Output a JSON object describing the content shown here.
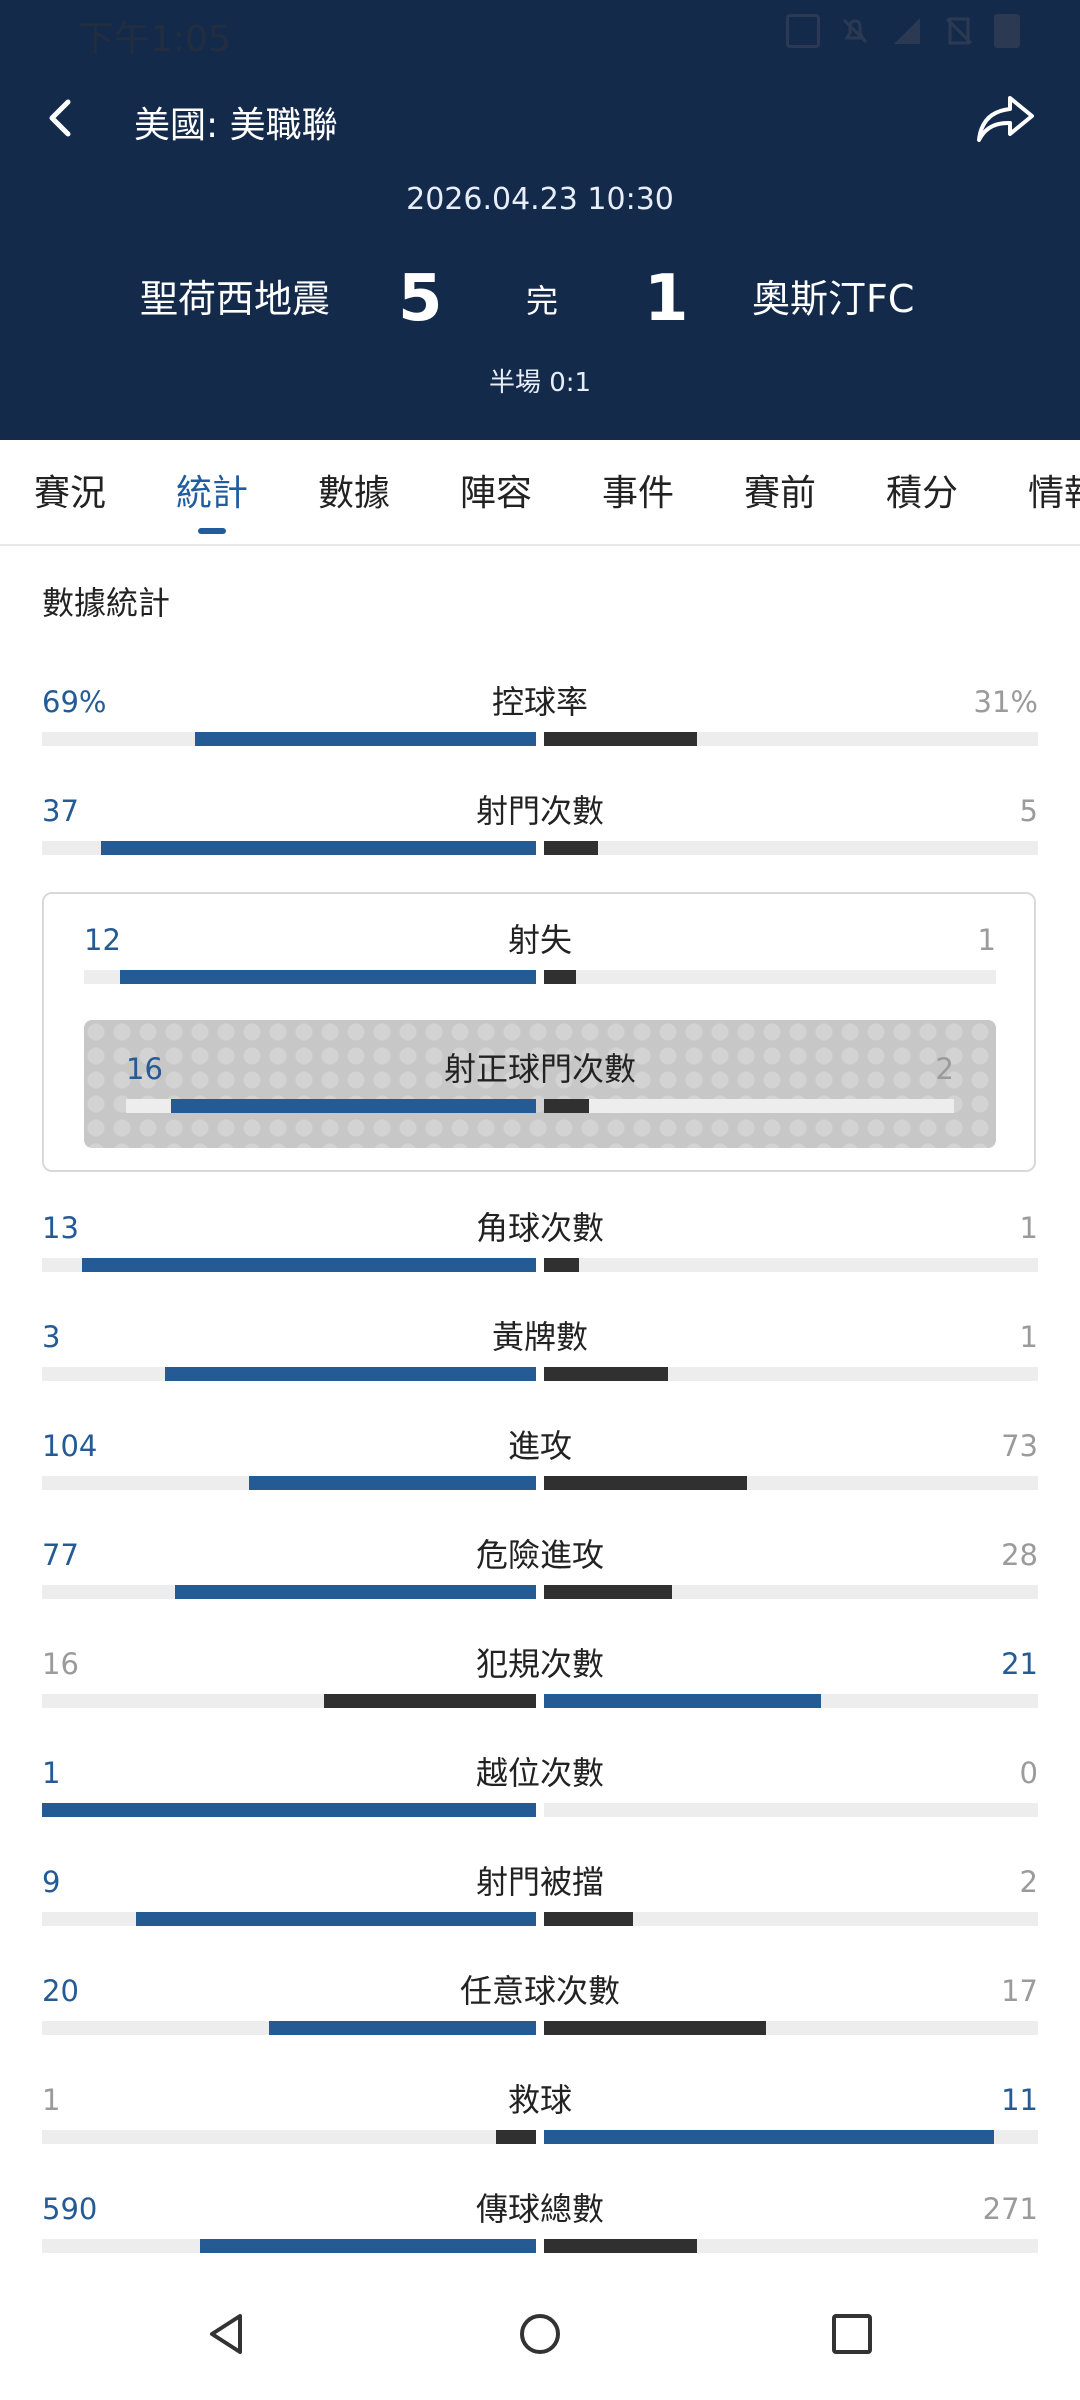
{
  "status": {
    "time": "下午1:05"
  },
  "header": {
    "league": "美國: 美職聯",
    "datetime": "2026.04.23 10:30",
    "home_team": "聖荷西地震",
    "away_team": "奧斯汀FC",
    "home_score": "5",
    "away_score": "1",
    "status": "完",
    "half_time": "半場 0:1"
  },
  "tabs": [
    "賽況",
    "統計",
    "數據",
    "陣容",
    "事件",
    "賽前",
    "積分",
    "情報"
  ],
  "active_tab": "統計",
  "section_title": "數據統計",
  "colors": {
    "header_bg": "#142a4b",
    "home_bar": "#255b95",
    "away_bar": "#303030",
    "track": "#ededed"
  },
  "stats": [
    {
      "label": "控球率",
      "home": "69%",
      "away": "31%",
      "home_frac": 0.69,
      "away_frac": 0.31,
      "leader": "home"
    },
    {
      "label": "射門次數",
      "home": "37",
      "away": "5",
      "home_frac": 0.88,
      "away_frac": 0.11,
      "leader": "home"
    },
    {
      "label": "射失",
      "home": "12",
      "away": "1",
      "home_frac": 0.92,
      "away_frac": 0.07,
      "leader": "home"
    },
    {
      "label": "射正球門次數",
      "home": "16",
      "away": "2",
      "home_frac": 0.89,
      "away_frac": 0.11,
      "leader": "home"
    },
    {
      "label": "角球次數",
      "home": "13",
      "away": "1",
      "home_frac": 0.92,
      "away_frac": 0.07,
      "leader": "home"
    },
    {
      "label": "黃牌數",
      "home": "3",
      "away": "1",
      "home_frac": 0.75,
      "away_frac": 0.25,
      "leader": "home"
    },
    {
      "label": "進攻",
      "home": "104",
      "away": "73",
      "home_frac": 0.58,
      "away_frac": 0.41,
      "leader": "home"
    },
    {
      "label": "危險進攻",
      "home": "77",
      "away": "28",
      "home_frac": 0.73,
      "away_frac": 0.26,
      "leader": "home"
    },
    {
      "label": "犯規次數",
      "home": "16",
      "away": "21",
      "home_frac": 0.43,
      "away_frac": 0.56,
      "leader": "away"
    },
    {
      "label": "越位次數",
      "home": "1",
      "away": "0",
      "home_frac": 1.0,
      "away_frac": 0.0,
      "leader": "home"
    },
    {
      "label": "射門被擋",
      "home": "9",
      "away": "2",
      "home_frac": 0.81,
      "away_frac": 0.18,
      "leader": "home"
    },
    {
      "label": "任意球次數",
      "home": "20",
      "away": "17",
      "home_frac": 0.54,
      "away_frac": 0.45,
      "leader": "home"
    },
    {
      "label": "救球",
      "home": "1",
      "away": "11",
      "home_frac": 0.08,
      "away_frac": 0.91,
      "leader": "away"
    },
    {
      "label": "傳球總數",
      "home": "590",
      "away": "271",
      "home_frac": 0.68,
      "away_frac": 0.31,
      "leader": "home"
    }
  ]
}
